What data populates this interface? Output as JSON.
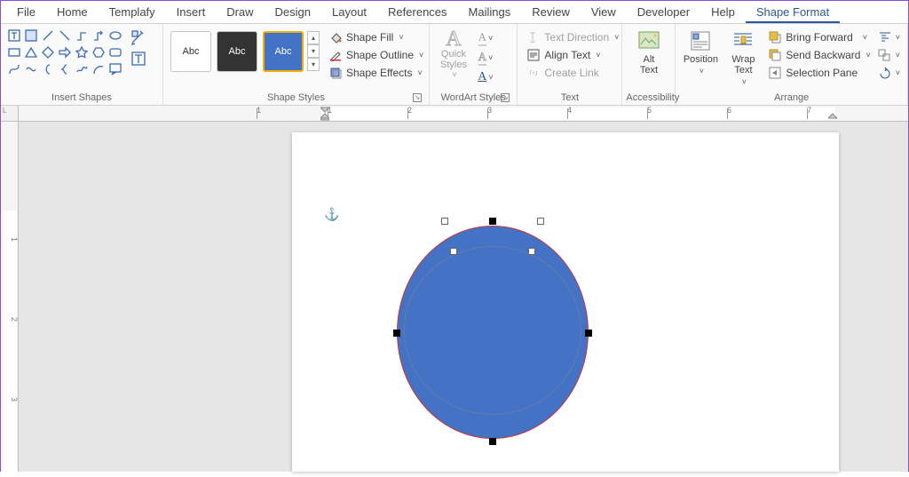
{
  "tabs": [
    "File",
    "Home",
    "Templafy",
    "Insert",
    "Draw",
    "Design",
    "Layout",
    "References",
    "Mailings",
    "Review",
    "View",
    "Developer",
    "Help",
    "Shape Format"
  ],
  "active_tab": "Shape Format",
  "groups": {
    "insert_shapes": "Insert Shapes",
    "shape_styles": "Shape Styles",
    "wordart_styles": "WordArt Styles",
    "text": "Text",
    "accessibility": "Accessibility",
    "arrange": "Arrange"
  },
  "style_thumbs": {
    "label": "Abc"
  },
  "shape_cmds": {
    "fill": "Shape Fill",
    "outline": "Shape Outline",
    "effects": "Shape Effects"
  },
  "wordart": {
    "quick_styles": "Quick\nStyles"
  },
  "text_cmds": {
    "direction": "Text Direction",
    "align": "Align Text",
    "link": "Create Link"
  },
  "accessibility": {
    "alt_text": "Alt\nText"
  },
  "arrange": {
    "position": "Position",
    "wrap": "Wrap\nText",
    "forward": "Bring Forward",
    "backward": "Send Backward",
    "selection": "Selection Pane"
  },
  "ruler": {
    "h_numbers": [
      "1",
      "1",
      "2",
      "3",
      "4",
      "5",
      "6",
      "7"
    ],
    "v_numbers": [
      "1",
      "2",
      "3"
    ]
  },
  "corner_label": "L"
}
